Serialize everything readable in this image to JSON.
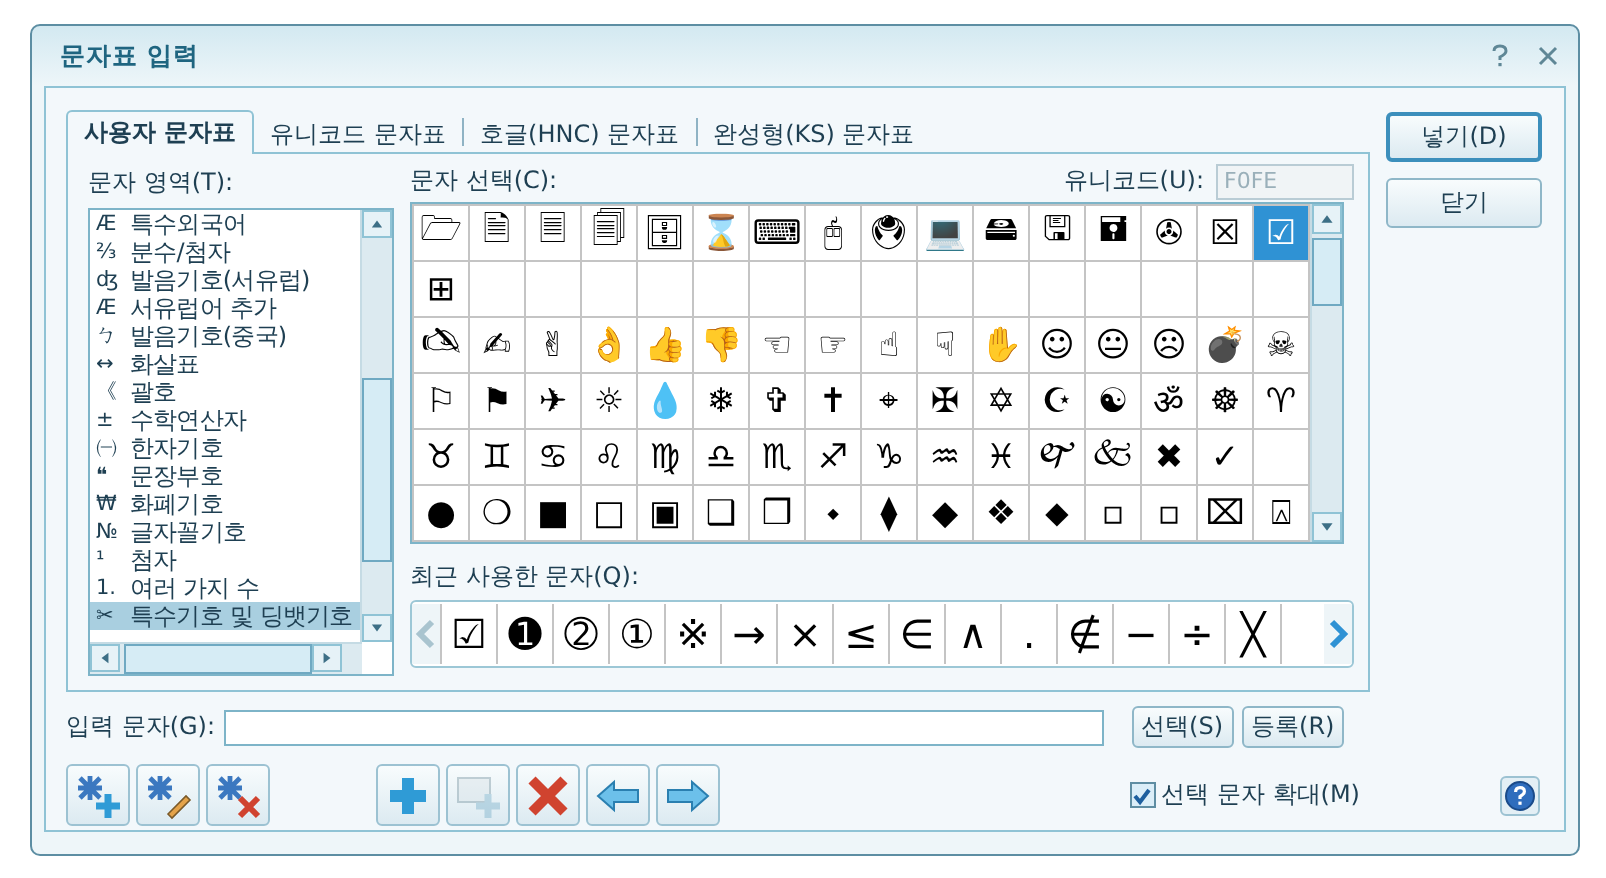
{
  "window": {
    "title": "문자표 입력"
  },
  "tabs": [
    {
      "label": "사용자 문자표",
      "selected": true
    },
    {
      "label": "유니코드 문자표",
      "selected": false
    },
    {
      "label": "호글(HNC) 문자표",
      "selected": false
    },
    {
      "label": "완성형(KS) 문자표",
      "selected": false
    }
  ],
  "area": {
    "label": "문자 영역(T):",
    "items": [
      {
        "icon": "Æ",
        "label": "특수외국어",
        "selected": false
      },
      {
        "icon": "⅔",
        "label": "분수/첨자",
        "selected": false
      },
      {
        "icon": "ʤ",
        "label": "발음기호(서유럽)",
        "selected": false
      },
      {
        "icon": "Æ",
        "label": "서유럽어 추가",
        "selected": false
      },
      {
        "icon": "ㄅ",
        "label": "발음기호(중국)",
        "selected": false
      },
      {
        "icon": "↔",
        "label": "화살표",
        "selected": false
      },
      {
        "icon": "《",
        "label": "괄호",
        "selected": false
      },
      {
        "icon": "±",
        "label": "수학연산자",
        "selected": false
      },
      {
        "icon": "㈠",
        "label": "한자기호",
        "selected": false
      },
      {
        "icon": "❝",
        "label": "문장부호",
        "selected": false
      },
      {
        "icon": "₩",
        "label": "화폐기호",
        "selected": false
      },
      {
        "icon": "№",
        "label": "글자꼴기호",
        "selected": false
      },
      {
        "icon": "¹",
        "label": "첨자",
        "selected": false
      },
      {
        "icon": "1.",
        "label": "여러 가지 수",
        "selected": false
      },
      {
        "icon": "✂",
        "label": "특수기호 및 딩뱃기호",
        "selected": true
      }
    ]
  },
  "select": {
    "label": "문자 선택(C):",
    "unicode_label": "유니코드(U):",
    "unicode_value": "F0FE",
    "rows": [
      [
        {
          "char": "🗁",
          "selected": false
        },
        {
          "char": "🗎",
          "selected": false
        },
        {
          "char": "🗏",
          "selected": false
        },
        {
          "char": "🗐",
          "selected": false
        },
        {
          "char": "🗄",
          "selected": false
        },
        {
          "char": "⌛",
          "selected": false
        },
        {
          "char": "⌨",
          "selected": false
        },
        {
          "char": "🖰",
          "selected": false
        },
        {
          "char": "🖲",
          "selected": false
        },
        {
          "char": "💻",
          "selected": false
        },
        {
          "char": "🖴",
          "selected": false
        },
        {
          "char": "🖫",
          "selected": false
        },
        {
          "char": "🖬",
          "selected": false
        },
        {
          "char": "✇",
          "selected": false
        },
        {
          "char": "☒",
          "selected": false
        },
        {
          "char": "☑",
          "selected": true
        }
      ],
      [
        {
          "char": "⊞",
          "selected": false
        },
        {
          "selected": false
        },
        {
          "selected": false
        },
        {
          "selected": false
        },
        {
          "selected": false
        },
        {
          "selected": false
        },
        {
          "selected": false
        },
        {
          "selected": false
        },
        {
          "selected": false
        },
        {
          "selected": false
        },
        {
          "selected": false
        },
        {
          "selected": false
        },
        {
          "selected": false
        },
        {
          "selected": false
        },
        {
          "selected": false
        },
        {
          "selected": false
        }
      ],
      [
        {
          "char": "🖎",
          "selected": false
        },
        {
          "char": "✍",
          "selected": false
        },
        {
          "char": "✌",
          "selected": false
        },
        {
          "char": "👌",
          "selected": false
        },
        {
          "char": "👍",
          "selected": false
        },
        {
          "char": "👎",
          "selected": false
        },
        {
          "char": "☜",
          "selected": false
        },
        {
          "char": "☞",
          "selected": false
        },
        {
          "char": "☝",
          "selected": false
        },
        {
          "char": "☟",
          "selected": false
        },
        {
          "char": "✋",
          "selected": false
        },
        {
          "char": "☺",
          "selected": false
        },
        {
          "char": "😐",
          "selected": false
        },
        {
          "char": "☹",
          "selected": false
        },
        {
          "char": "💣",
          "selected": false
        },
        {
          "char": "☠",
          "selected": false
        }
      ],
      [
        {
          "char": "⚐",
          "selected": false
        },
        {
          "char": "⚑",
          "selected": false
        },
        {
          "char": "✈",
          "selected": false
        },
        {
          "char": "☼",
          "selected": false
        },
        {
          "char": "💧",
          "selected": false
        },
        {
          "char": "❄",
          "selected": false
        },
        {
          "char": "✞",
          "selected": false
        },
        {
          "char": "✝",
          "selected": false
        },
        {
          "char": "⌖",
          "selected": false
        },
        {
          "char": "✠",
          "selected": false
        },
        {
          "char": "✡",
          "selected": false
        },
        {
          "char": "☪",
          "selected": false
        },
        {
          "char": "☯",
          "selected": false
        },
        {
          "char": "ॐ",
          "selected": false
        },
        {
          "char": "☸",
          "selected": false
        },
        {
          "char": "♈",
          "selected": false
        }
      ],
      [
        {
          "char": "♉",
          "selected": false
        },
        {
          "char": "♊",
          "selected": false
        },
        {
          "char": "♋",
          "selected": false
        },
        {
          "char": "♌",
          "selected": false
        },
        {
          "char": "♍",
          "selected": false
        },
        {
          "char": "♎",
          "selected": false
        },
        {
          "char": "♏",
          "selected": false
        },
        {
          "char": "♐",
          "selected": false
        },
        {
          "char": "♑",
          "selected": false
        },
        {
          "char": "♒",
          "selected": false
        },
        {
          "char": "♓",
          "selected": false
        },
        {
          "char": "🙰",
          "selected": false
        },
        {
          "char": "🙵",
          "selected": false
        },
        {
          "char": "✖",
          "selected": false
        },
        {
          "char": "✓",
          "selected": false
        },
        {
          "selected": false
        }
      ],
      [
        {
          "char": "●",
          "selected": false
        },
        {
          "char": "❍",
          "selected": false
        },
        {
          "char": "■",
          "selected": false
        },
        {
          "char": "□",
          "selected": false
        },
        {
          "char": "▣",
          "selected": false
        },
        {
          "char": "❑",
          "selected": false
        },
        {
          "char": "❒",
          "selected": false
        },
        {
          "char": "⬩",
          "selected": false
        },
        {
          "char": "⧫",
          "selected": false
        },
        {
          "char": "◆",
          "selected": false
        },
        {
          "char": "❖",
          "selected": false
        },
        {
          "char": "⬥",
          "selected": false
        },
        {
          "char": "▫",
          "selected": false
        },
        {
          "char": "▫",
          "selected": false
        },
        {
          "char": "⌧",
          "selected": false
        },
        {
          "char": "⍓",
          "selected": false
        }
      ]
    ]
  },
  "recent": {
    "label": "최근 사용한 문자(Q):",
    "chars": [
      "☑",
      "➊",
      "➁",
      "①",
      "※",
      "→",
      "×",
      "≤",
      "∈",
      "∧",
      ".",
      "∉",
      "−",
      "÷",
      "╳"
    ]
  },
  "buttons": [
    {
      "label": "넣기(D)",
      "default": true
    },
    {
      "label": "닫기",
      "default": false
    }
  ],
  "input": {
    "label": "입력 문자(G):",
    "select_button": "선택(S)",
    "register_button": "등록(R)"
  },
  "toolbar_left": [
    {
      "disabled": false
    },
    {
      "disabled": false
    },
    {
      "disabled": false
    }
  ],
  "toolbar_right": [
    {
      "disabled": false
    },
    {
      "disabled": true
    },
    {
      "disabled": false
    },
    {
      "disabled": false
    },
    {
      "disabled": false
    }
  ],
  "enlarge": {
    "label": "선택 문자 확대(M)",
    "checked": true
  }
}
